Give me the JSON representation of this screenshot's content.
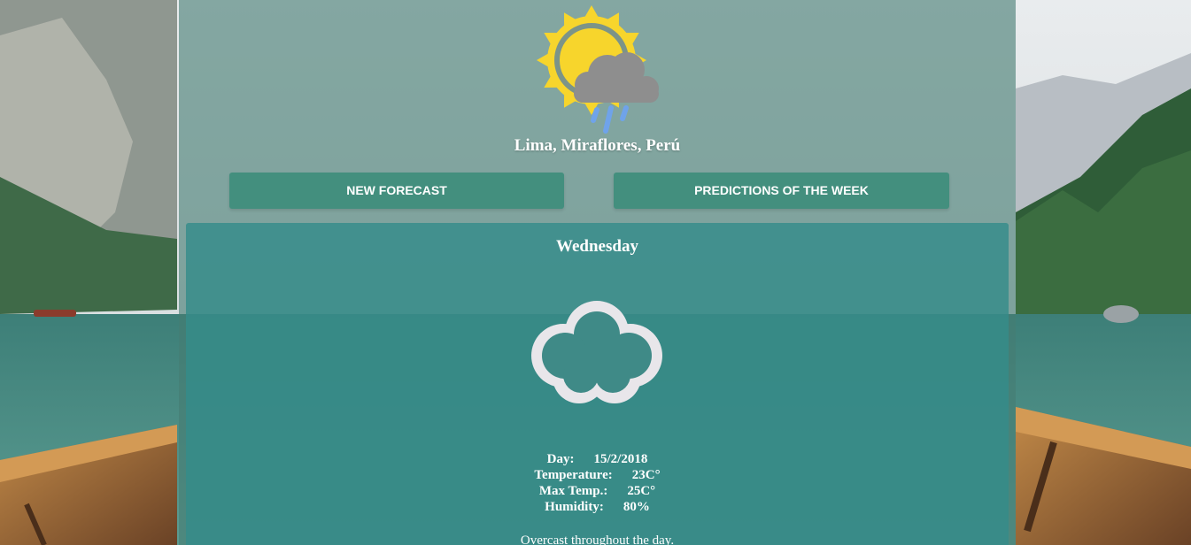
{
  "header": {
    "location": "Lima, Miraflores, Perú",
    "logo_icon": "sun-cloud-rain-icon"
  },
  "actions": {
    "new_forecast_label": "NEW FORECAST",
    "predictions_label": "PREDICTIONS OF THE WEEK"
  },
  "forecast": {
    "day_name": "Wednesday",
    "condition_icon": "cloud-icon",
    "details": [
      {
        "label": "Day:",
        "value": "15/2/2018"
      },
      {
        "label": "Temperature:",
        "value": "23C°"
      },
      {
        "label": "Max Temp.:",
        "value": "25C°"
      },
      {
        "label": "Humidity:",
        "value": "80%"
      }
    ],
    "summary": "Overcast throughout the day."
  },
  "colors": {
    "panel": "#467d73",
    "button": "#3a8c7a",
    "card": "#348c8a",
    "sun": "#f7d52c",
    "rain_cloud": "#8e8e8e",
    "rain_drops": "#6fa3ea",
    "cloud_outline": "#e8e6ea"
  }
}
